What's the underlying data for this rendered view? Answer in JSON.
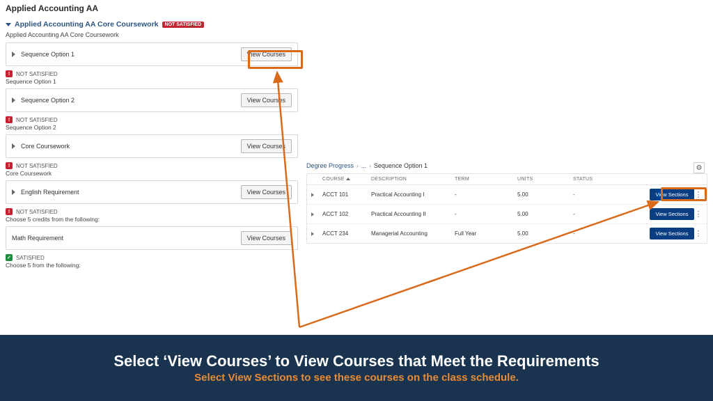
{
  "pageTitle": "Applied Accounting AA",
  "section": {
    "title": "Applied Accounting AA Core Coursework",
    "badge": "NOT SATISFIED",
    "subtitle": "Applied Accounting AA Core Coursework"
  },
  "viewCoursesLabel": "View Courses",
  "statusNotSat": "NOT SATISFIED",
  "statusSat": "SATISFIED",
  "requirements": [
    {
      "name": "Sequence Option 1",
      "status": "not",
      "sub": "Sequence Option 1"
    },
    {
      "name": "Sequence Option 2",
      "status": "not",
      "sub": "Sequence Option 2"
    },
    {
      "name": "Core Coursework",
      "status": "not",
      "sub": "Core Coursework"
    },
    {
      "name": "English Requirement",
      "status": "not",
      "sub": "Choose 5 credits from the following:"
    },
    {
      "name": "Math Requirement",
      "status": "sat",
      "sub": "Choose 5 from the following:"
    }
  ],
  "right": {
    "breadcrumb": {
      "root": "Degree Progress",
      "mid": "...",
      "current": "Sequence Option 1"
    },
    "columns": {
      "course": "COURSE",
      "description": "DESCRIPTION",
      "term": "TERM",
      "units": "UNITS",
      "status": "STATUS"
    },
    "viewSectionsLabel": "View Sections",
    "rows": [
      {
        "course": "ACCT 101",
        "description": "Practical Accounting I",
        "term": "-",
        "units": "5.00",
        "status": "-"
      },
      {
        "course": "ACCT 102",
        "description": "Practical Accounting II",
        "term": "-",
        "units": "5.00",
        "status": "-"
      },
      {
        "course": "ACCT 234",
        "description": "Managerial Accounting",
        "term": "Full Year",
        "units": "5.00",
        "status": "-"
      }
    ]
  },
  "footer": {
    "main": "Select ‘View Courses’ to View Courses that Meet the Requirements",
    "sub": "Select View Sections to see these courses on the class schedule."
  }
}
